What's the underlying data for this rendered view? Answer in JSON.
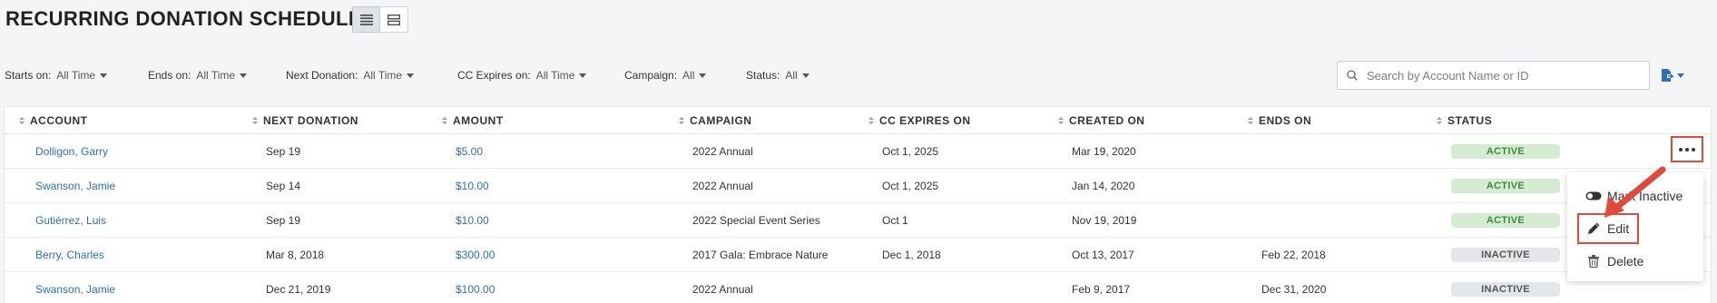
{
  "page": {
    "title": "RECURRING DONATION SCHEDULES"
  },
  "view_toggle": {
    "list": "list-view-icon",
    "card": "card-view-icon"
  },
  "filters": [
    {
      "label": "Starts on:",
      "value": "All Time"
    },
    {
      "label": "Ends on:",
      "value": "All Time"
    },
    {
      "label": "Next Donation:",
      "value": "All Time"
    },
    {
      "label": "CC Expires on:",
      "value": "All Time"
    },
    {
      "label": "Campaign:",
      "value": "All"
    },
    {
      "label": "Status:",
      "value": "All"
    }
  ],
  "search": {
    "placeholder": "Search by Account Name or ID",
    "value": ""
  },
  "table": {
    "columns": [
      "ACCOUNT",
      "NEXT DONATION",
      "AMOUNT",
      "CAMPAIGN",
      "CC EXPIRES ON",
      "CREATED ON",
      "ENDS ON",
      "STATUS"
    ],
    "rows": [
      {
        "account": "Dolligon, Garry",
        "next_donation": "Sep 19",
        "amount": "$5.00",
        "campaign": "2022 Annual",
        "cc_expires": "Oct 1, 2025",
        "created": "Mar 19, 2020",
        "ends": "",
        "status": "ACTIVE"
      },
      {
        "account": "Swanson, Jamie",
        "next_donation": "Sep 14",
        "amount": "$10.00",
        "campaign": "2022 Annual",
        "cc_expires": "Oct 1, 2025",
        "created": "Jan 14, 2020",
        "ends": "",
        "status": "ACTIVE"
      },
      {
        "account": "Gutiérrez, Luis",
        "next_donation": "Sep 19",
        "amount": "$10.00",
        "campaign": "2022 Special Event Series",
        "cc_expires": "Oct 1",
        "created": "Nov 19, 2019",
        "ends": "",
        "status": "ACTIVE"
      },
      {
        "account": "Berry, Charles",
        "next_donation": "Mar 8, 2018",
        "amount": "$300.00",
        "campaign": "2017 Gala: Embrace Nature",
        "cc_expires": "Dec 1, 2018",
        "created": "Oct 13, 2017",
        "ends": "Feb 22, 2018",
        "status": "INACTIVE"
      },
      {
        "account": "Swanson, Jamie",
        "next_donation": "Dec 21, 2019",
        "amount": "$100.00",
        "campaign": "2022 Annual",
        "cc_expires": "",
        "created": "Feb 9, 2017",
        "ends": "Dec 31, 2020",
        "status": "INACTIVE"
      }
    ]
  },
  "row_menu": {
    "items": [
      {
        "label": "Mark Inactive",
        "icon": "toggle-icon"
      },
      {
        "label": "Edit",
        "icon": "pencil-icon"
      },
      {
        "label": "Delete",
        "icon": "trash-icon"
      }
    ]
  },
  "colors": {
    "link": "#2f6fb6",
    "active_bg": "#d6ecd2",
    "active_text": "#3d8a3d",
    "highlight": "#e04a3a"
  }
}
